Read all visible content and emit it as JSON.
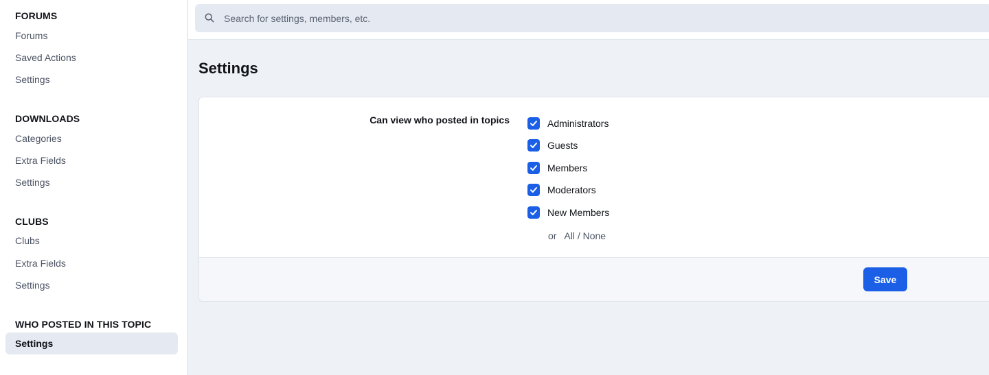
{
  "sidebar": {
    "sections": [
      {
        "title": "FORUMS",
        "items": [
          "Forums",
          "Saved Actions",
          "Settings"
        ]
      },
      {
        "title": "DOWNLOADS",
        "items": [
          "Categories",
          "Extra Fields",
          "Settings"
        ]
      },
      {
        "title": "CLUBS",
        "items": [
          "Clubs",
          "Extra Fields",
          "Settings"
        ]
      },
      {
        "title": "WHO POSTED IN THIS TOPIC",
        "items": [
          "Settings"
        ]
      }
    ],
    "active_item": "Settings"
  },
  "search": {
    "placeholder": "Search for settings, members, etc."
  },
  "page": {
    "title": "Settings"
  },
  "form": {
    "field_label": "Can view who posted in topics",
    "options": [
      {
        "label": "Administrators",
        "checked": true
      },
      {
        "label": "Guests",
        "checked": true
      },
      {
        "label": "Members",
        "checked": true
      },
      {
        "label": "Moderators",
        "checked": true
      },
      {
        "label": "New Members",
        "checked": true
      }
    ],
    "or_text": "or",
    "all_label": "All",
    "separator": "/",
    "none_label": "None",
    "save_label": "Save"
  },
  "colors": {
    "accent": "#1a5fe6",
    "active_nav_bg": "#e5e9f2",
    "page_bg": "#eef1f6"
  }
}
